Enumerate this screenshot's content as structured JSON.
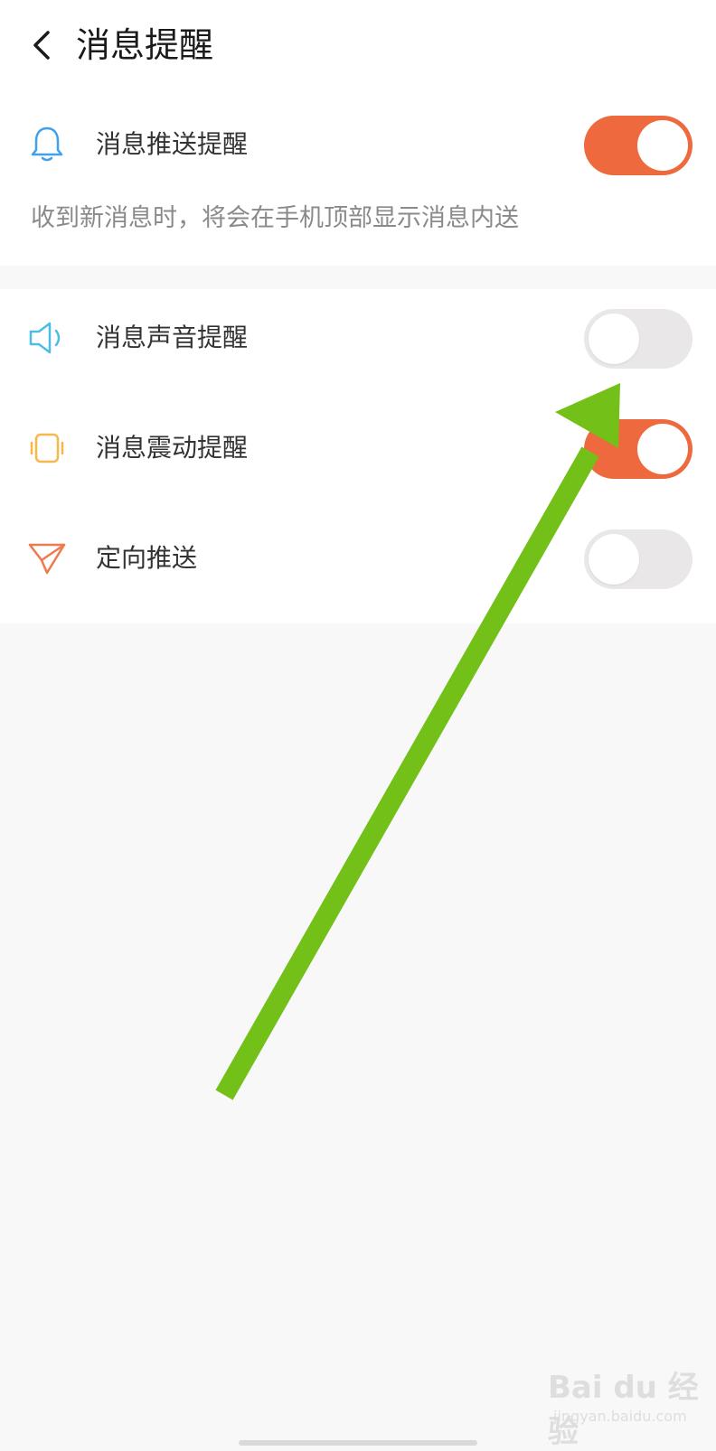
{
  "header": {
    "title": "消息提醒",
    "back_icon": "chevron-left-icon"
  },
  "push": {
    "label": "消息推送提醒",
    "icon": "bell-icon",
    "enabled": true,
    "description": "收到新消息时，将会在手机顶部显示消息内送"
  },
  "sound": {
    "label": "消息声音提醒",
    "icon": "speaker-icon",
    "enabled": false
  },
  "vibrate": {
    "label": "消息震动提醒",
    "icon": "vibrate-icon",
    "enabled": true
  },
  "directed": {
    "label": "定向推送",
    "icon": "paper-plane-icon",
    "enabled": false
  },
  "watermark": {
    "logo": "Bai du 经验",
    "sub": "jingyan.baidu.com"
  },
  "colors": {
    "toggle_on": "#ef693e",
    "toggle_off": "#e9e7e7",
    "annotation_arrow": "#72c018"
  }
}
